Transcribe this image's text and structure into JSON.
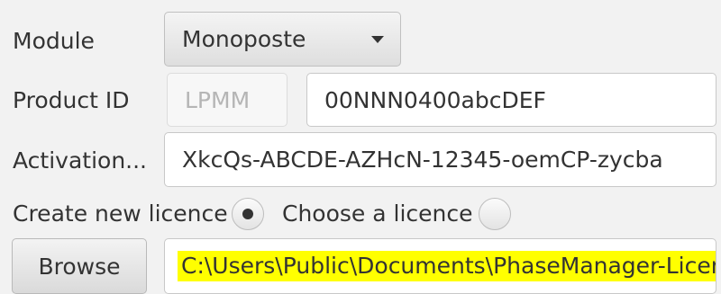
{
  "module": {
    "label": "Module",
    "selected": "Monoposte"
  },
  "product_id": {
    "label": "Product ID",
    "prefix": "LPMM",
    "value": "00NNN0400abcDEF"
  },
  "activation": {
    "label": "Activation...",
    "value": "XkcQs-ABCDE-AZHcN-12345-oemCP-zycba"
  },
  "licence_options": {
    "create_label": "Create new licence",
    "create_selected": true,
    "choose_label": "Choose a licence",
    "choose_selected": false
  },
  "browse": {
    "button_label": "Browse",
    "path": "C:\\Users\\Public\\Documents\\PhaseManager-Licence"
  },
  "colors": {
    "background": "#f2f2f2",
    "highlight": "#ffff00"
  }
}
